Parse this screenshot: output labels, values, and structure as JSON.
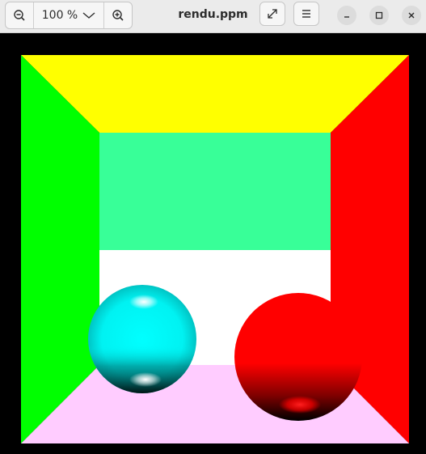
{
  "header": {
    "title": "rendu.ppm",
    "zoom": {
      "label": "100 %",
      "out_icon": "zoom-out-icon",
      "in_icon": "zoom-in-icon",
      "dropdown_icon": "chevron-down-icon"
    },
    "actions": {
      "fullscreen_icon": "fullscreen-icon",
      "menu_icon": "hamburger-menu-icon"
    },
    "window_controls": {
      "minimize_icon": "minimize-icon",
      "maximize_icon": "maximize-icon",
      "close_icon": "close-icon"
    }
  },
  "scene": {
    "colors": {
      "left_wall": "#00ff00",
      "right_wall": "#ff0000",
      "ceiling": "#ffff00",
      "back_wall": "#38ff98",
      "floor": "#ffccff",
      "back_floor_strip": "#ffffff",
      "cyan_sphere": "#00ffff",
      "red_sphere": "#ff0000",
      "border": "#000000"
    }
  }
}
